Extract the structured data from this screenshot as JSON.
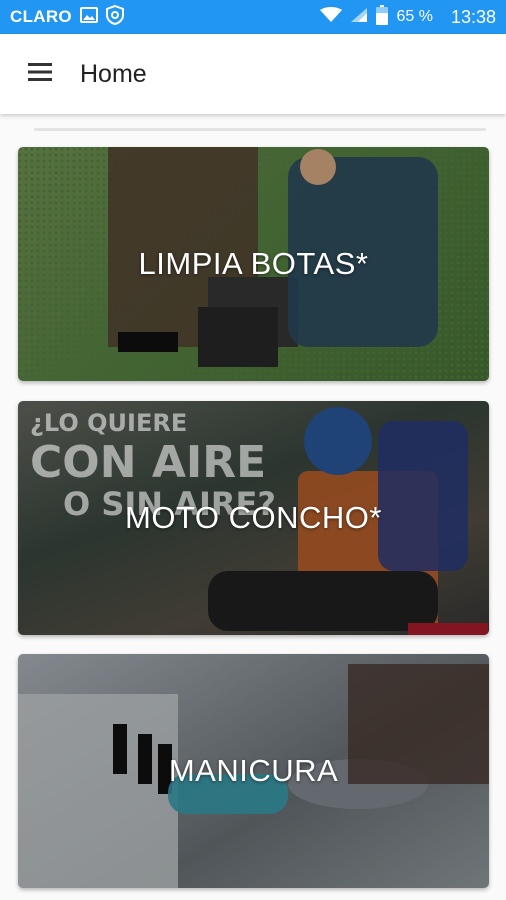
{
  "status_bar": {
    "carrier": "CLARO",
    "battery": "65 %",
    "time": "13:38"
  },
  "app_bar": {
    "title": "Home"
  },
  "cards": [
    {
      "label": "LIMPIA BOTAS*"
    },
    {
      "label": "MOTO CONCHO*",
      "overlay_line1": "¿LO QUIERE",
      "overlay_line2": "CON AIRE",
      "overlay_line3": "O SIN AIRE?"
    },
    {
      "label": "MANICURA"
    }
  ],
  "colors": {
    "status_bar": "#2196F3",
    "app_bar": "#FFFFFF"
  }
}
